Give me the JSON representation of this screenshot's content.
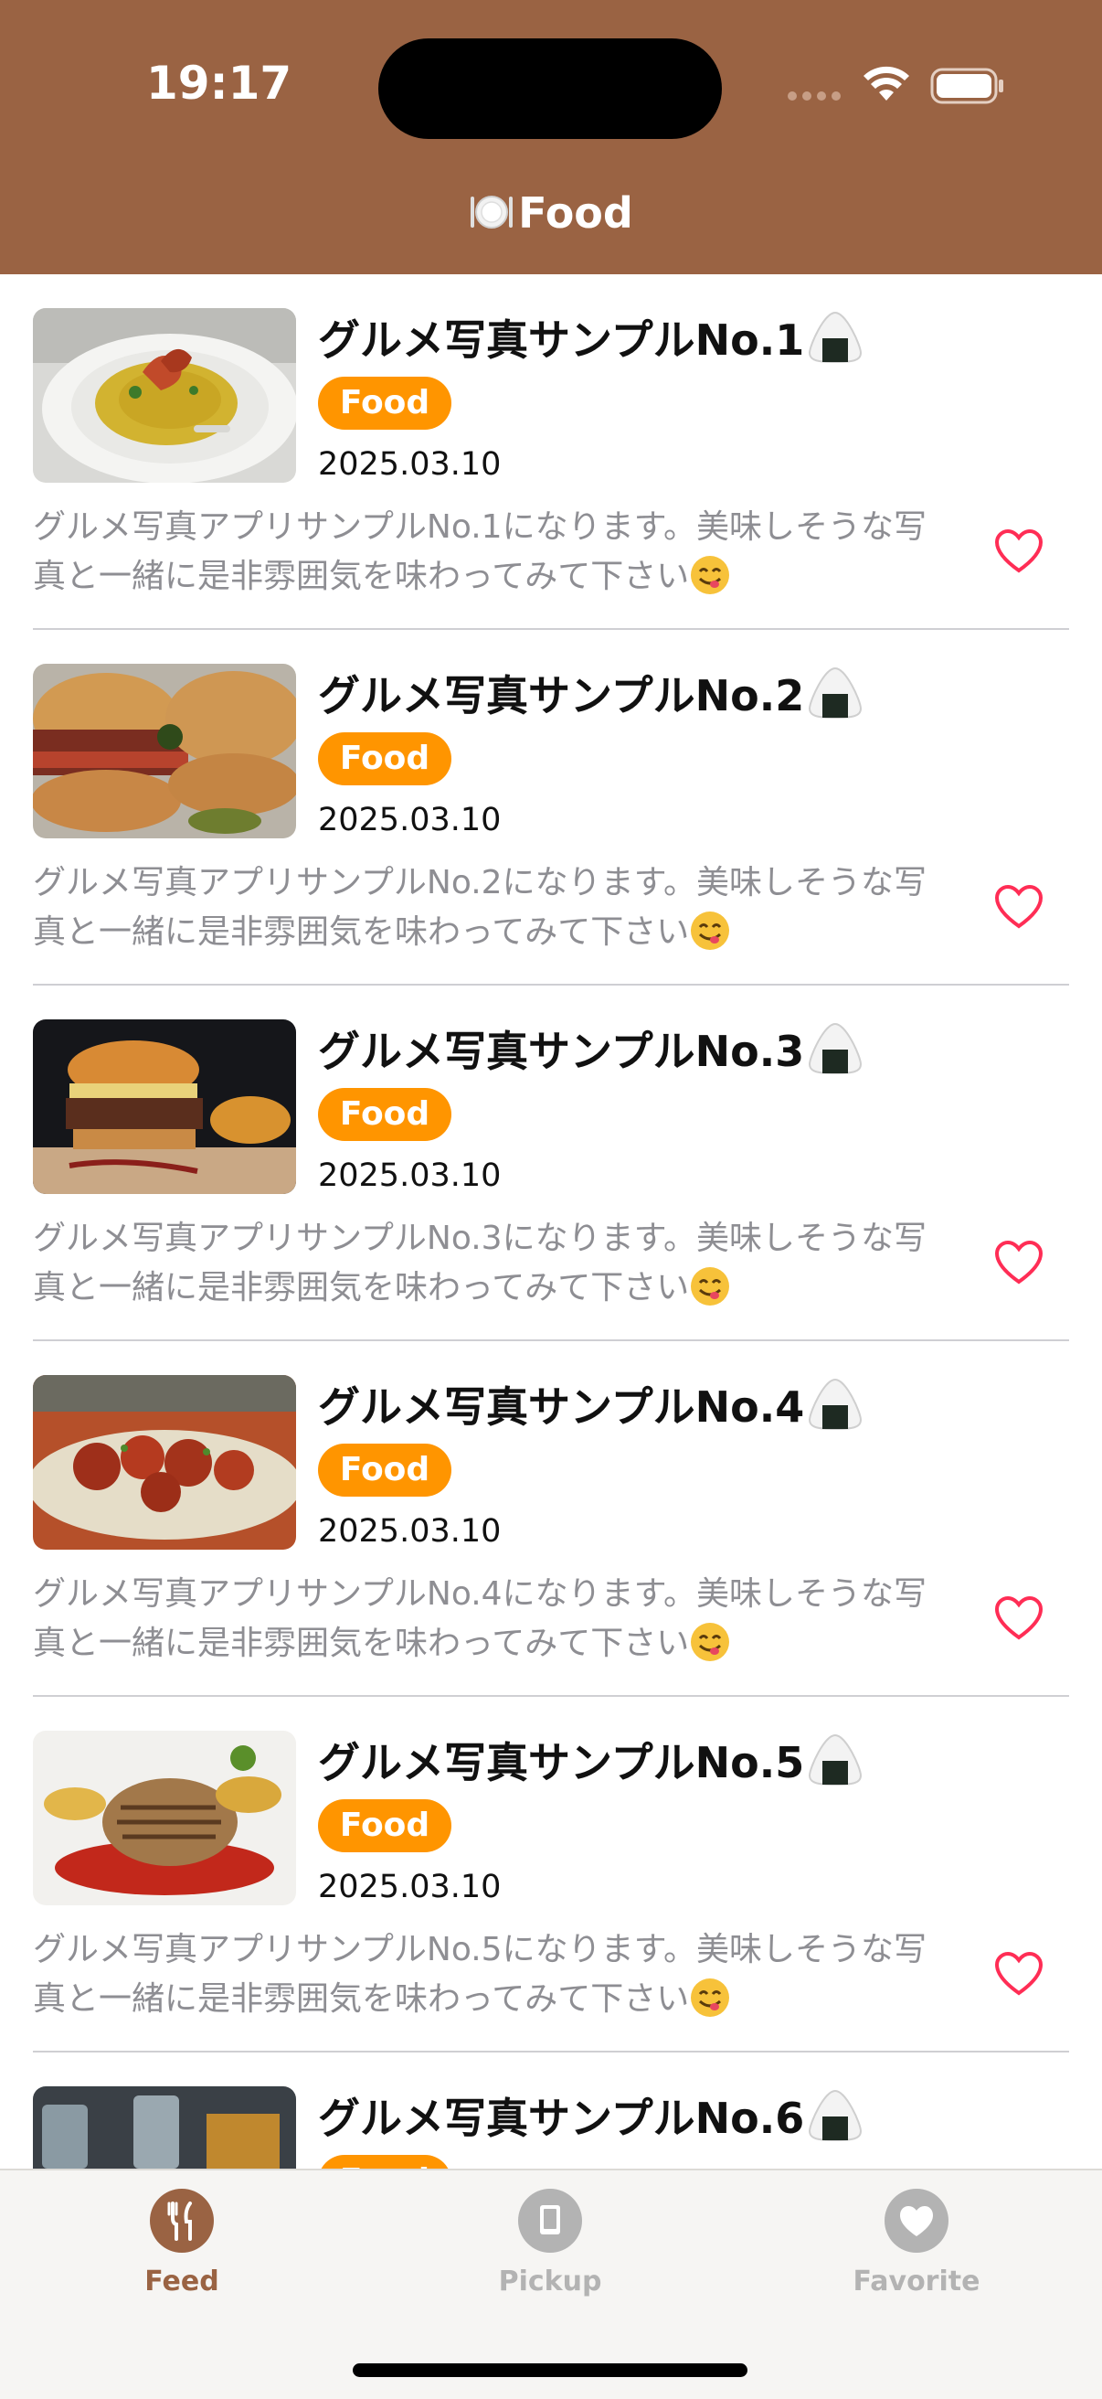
{
  "status_bar": {
    "time": "19:17"
  },
  "nav": {
    "title": "Food",
    "title_icon": "plate-icon"
  },
  "colors": {
    "header_bg": "#9a6343",
    "badge_bg": "#ff9500",
    "heart": "#ff2d55",
    "tab_active": "#9a6343",
    "tab_inactive": "#b3b3b3"
  },
  "feed": {
    "items": [
      {
        "title": "グルメ写真サンプルNo.1",
        "category": "Food",
        "date": "2025.03.10",
        "description": "グルメ写真アプリサンプルNo.1になります。美味しそうな写真と一緒に是非雰囲気を味わってみて下さい",
        "favorited": false
      },
      {
        "title": "グルメ写真サンプルNo.2",
        "category": "Food",
        "date": "2025.03.10",
        "description": "グルメ写真アプリサンプルNo.2になります。美味しそうな写真と一緒に是非雰囲気を味わってみて下さい",
        "favorited": false
      },
      {
        "title": "グルメ写真サンプルNo.3",
        "category": "Food",
        "date": "2025.03.10",
        "description": "グルメ写真アプリサンプルNo.3になります。美味しそうな写真と一緒に是非雰囲気を味わってみて下さい",
        "favorited": false
      },
      {
        "title": "グルメ写真サンプルNo.4",
        "category": "Food",
        "date": "2025.03.10",
        "description": "グルメ写真アプリサンプルNo.4になります。美味しそうな写真と一緒に是非雰囲気を味わってみて下さい",
        "favorited": false
      },
      {
        "title": "グルメ写真サンプルNo.5",
        "category": "Food",
        "date": "2025.03.10",
        "description": "グルメ写真アプリサンプルNo.5になります。美味しそうな写真と一緒に是非雰囲気を味わってみて下さい",
        "favorited": false
      },
      {
        "title": "グルメ写真サンプルNo.6",
        "category": "Food",
        "date": "",
        "description": "",
        "favorited": false
      }
    ]
  },
  "tabbar": {
    "tabs": [
      {
        "label": "Feed",
        "icon": "fork-knife-icon",
        "active": true
      },
      {
        "label": "Pickup",
        "icon": "book-icon",
        "active": false
      },
      {
        "label": "Favorite",
        "icon": "heart-icon",
        "active": false
      }
    ]
  }
}
